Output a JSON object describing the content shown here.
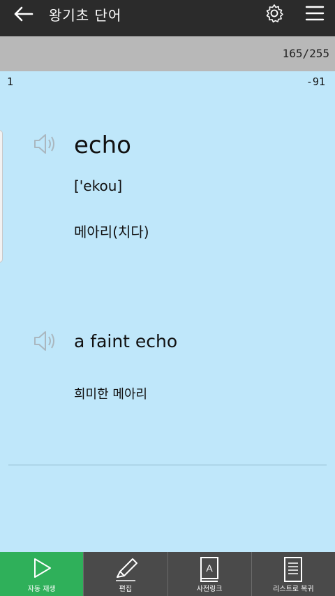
{
  "header": {
    "title": "왕기초 단어",
    "back_icon": "arrow-left-icon",
    "settings_icon": "gear-icon",
    "menu_icon": "hamburger-menu-icon"
  },
  "progress": {
    "count": "165/255"
  },
  "card": {
    "index_left": "1",
    "index_right": "-91",
    "word": "echo",
    "phonetic": "['ekou]",
    "meaning": "메아리(치다)",
    "example": "a faint echo",
    "example_meaning": "희미한 메아리"
  },
  "toolbar": {
    "items": [
      {
        "label": "자동 재생",
        "icon": "play-icon"
      },
      {
        "label": "편집",
        "icon": "pencil-icon"
      },
      {
        "label": "사전링크",
        "icon": "dictionary-book-icon"
      },
      {
        "label": "리스트로 복귀",
        "icon": "list-document-icon"
      }
    ]
  },
  "colors": {
    "background": "#bfe7fa",
    "topbar": "#2b2b2b",
    "progress": "#b8b8b8",
    "active_tab": "#2fb05a",
    "bottombar": "#4a4a4a"
  }
}
